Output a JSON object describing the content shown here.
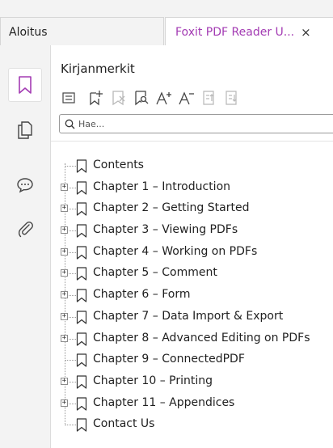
{
  "tabs": {
    "home_label": "Aloitus",
    "doc_label": "Foxit PDF Reader U...",
    "close_glyph": "×"
  },
  "panel": {
    "title": "Kirjanmerkit",
    "search_placeholder": "Hae..."
  },
  "colors": {
    "accent": "#a33bb3",
    "icon": "#444444",
    "disabled_icon": "#b8b8b8"
  },
  "bookmarks": [
    {
      "label": "Contents",
      "expandable": false
    },
    {
      "label": "Chapter 1 – Introduction",
      "expandable": true
    },
    {
      "label": "Chapter 2 – Getting Started",
      "expandable": true
    },
    {
      "label": "Chapter 3 – Viewing PDFs",
      "expandable": true
    },
    {
      "label": "Chapter 4 – Working on PDFs",
      "expandable": true
    },
    {
      "label": "Chapter 5 – Comment",
      "expandable": true
    },
    {
      "label": "Chapter 6 – Form",
      "expandable": true
    },
    {
      "label": "Chapter 7 – Data Import & Export",
      "expandable": true
    },
    {
      "label": "Chapter 8 – Advanced Editing on PDFs",
      "expandable": true
    },
    {
      "label": "Chapter 9 – ConnectedPDF",
      "expandable": false
    },
    {
      "label": "Chapter 10 – Printing",
      "expandable": true
    },
    {
      "label": "Chapter 11 – Appendices",
      "expandable": true
    },
    {
      "label": "Contact Us",
      "expandable": false
    }
  ],
  "toolbar_icons": [
    "options-menu-icon",
    "add-bookmark-icon",
    "delete-bookmark-icon",
    "find-current-bookmark-icon",
    "expand-font-icon",
    "shrink-font-icon",
    "promote-icon",
    "demote-icon"
  ],
  "rail_icons": [
    "bookmark-panel-icon",
    "pages-panel-icon",
    "comments-panel-icon",
    "attachments-panel-icon"
  ]
}
